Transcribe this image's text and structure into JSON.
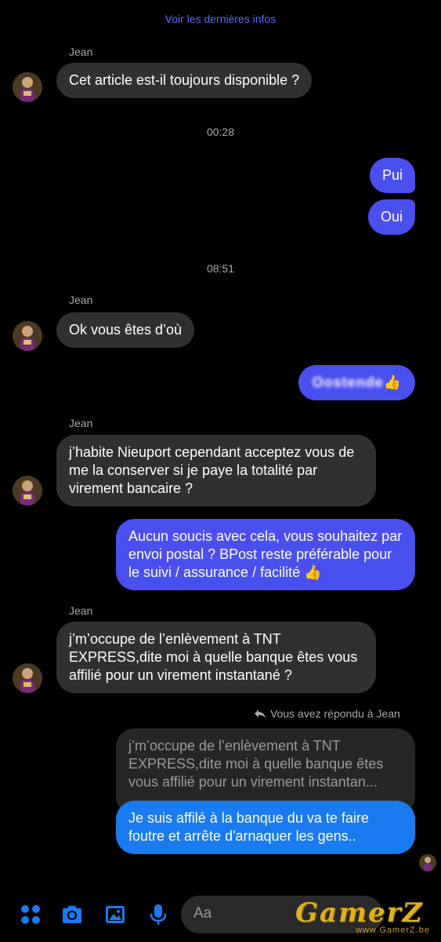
{
  "header": {
    "see_latest": "Voir les dernières infos"
  },
  "messages": {
    "m1": {
      "sender": "Jean",
      "text": "Cet article est-il toujours disponible ?"
    },
    "time1": "00:28",
    "m2": {
      "text": "Pui"
    },
    "m3": {
      "text": "Oui"
    },
    "time2": "08:51",
    "m4": {
      "sender": "Jean",
      "text": "Ok vous êtes d’où"
    },
    "m5": {
      "text": "Oostende",
      "emoji": "👍"
    },
    "m6": {
      "sender": "Jean",
      "text": "j’habite Nieuport cependant acceptez vous de  me la conserver si je paye la totalité par virement bancaire ?"
    },
    "m7": {
      "text": "Aucun soucis avec cela, vous souhaitez par envoi postal ? BPost reste préférable pour le suivi / assurance / facilité",
      "emoji": "👍"
    },
    "m8": {
      "sender": "Jean",
      "text": "j’m’occupe de l’enlèvement à TNT EXPRESS,dite moi à quelle banque êtes vous affilié pour un virement instantané ?"
    },
    "reply_note": "Vous avez répondu à Jean",
    "quoted": "j’m’occupe de l’enlèvement à TNT EXPRESS,dite moi à quelle banque êtes vous affilié pour un virement instantan...",
    "m9": {
      "text": "Je suis affilé à la banque du va te faire foutre et arrête d'arnaquer les gens.."
    }
  },
  "composer": {
    "placeholder": "Aa"
  },
  "watermark": {
    "main": "GamerZ",
    "sub": "www.GamerZ.be"
  },
  "colors": {
    "outgoing": "#4a4ff0",
    "outgoing_reply": "#1a7af0",
    "incoming": "#303030",
    "link": "#5b6bff",
    "toolbar_icons": "#1a7af0"
  },
  "icons": [
    "apps-icon",
    "camera-icon",
    "gallery-icon",
    "microphone-icon",
    "emoji-icon",
    "reply-icon",
    "avatar"
  ]
}
